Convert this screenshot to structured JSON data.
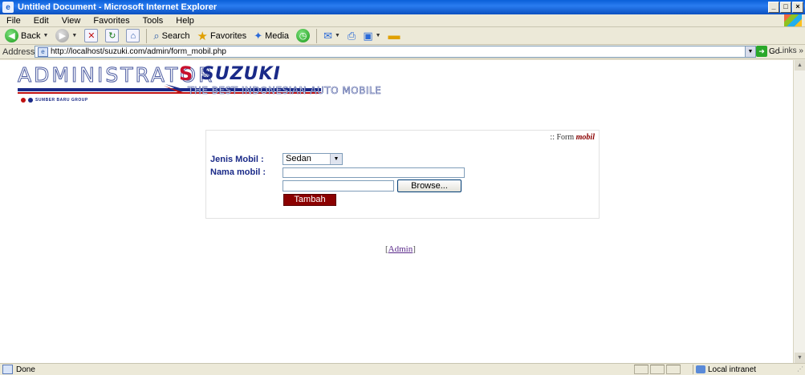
{
  "window": {
    "title": "Untitled Document - Microsoft Internet Explorer",
    "minimize": "_",
    "maximize": "□",
    "close": "×"
  },
  "menu": [
    "File",
    "Edit",
    "View",
    "Favorites",
    "Tools",
    "Help"
  ],
  "toolbar": {
    "back": "Back",
    "search": "Search",
    "favorites": "Favorites",
    "media": "Media"
  },
  "address": {
    "label": "Address",
    "url": "http://localhost/suzuki.com/admin/form_mobil.php",
    "go": "Go",
    "links": "Links"
  },
  "header": {
    "admin": "ADMINISTRATOR",
    "brand": "SUZUKI",
    "group": "SUMBER BARU GROUP",
    "tagline": "THE BEST INDONESIAN AUTO MOBILE"
  },
  "form": {
    "title_prefix": ":: Form ",
    "title_em": "mobil",
    "jenis_label": "Jenis Mobil  :",
    "jenis_value": "Sedan",
    "nama_label": "Nama mobil :",
    "nama_value": "",
    "browse": "Browse...",
    "submit": "Tambah"
  },
  "footer": {
    "open": "[",
    "link": "Admin",
    "close": "]"
  },
  "status": {
    "text": "Done",
    "zone": "Local intranet"
  }
}
